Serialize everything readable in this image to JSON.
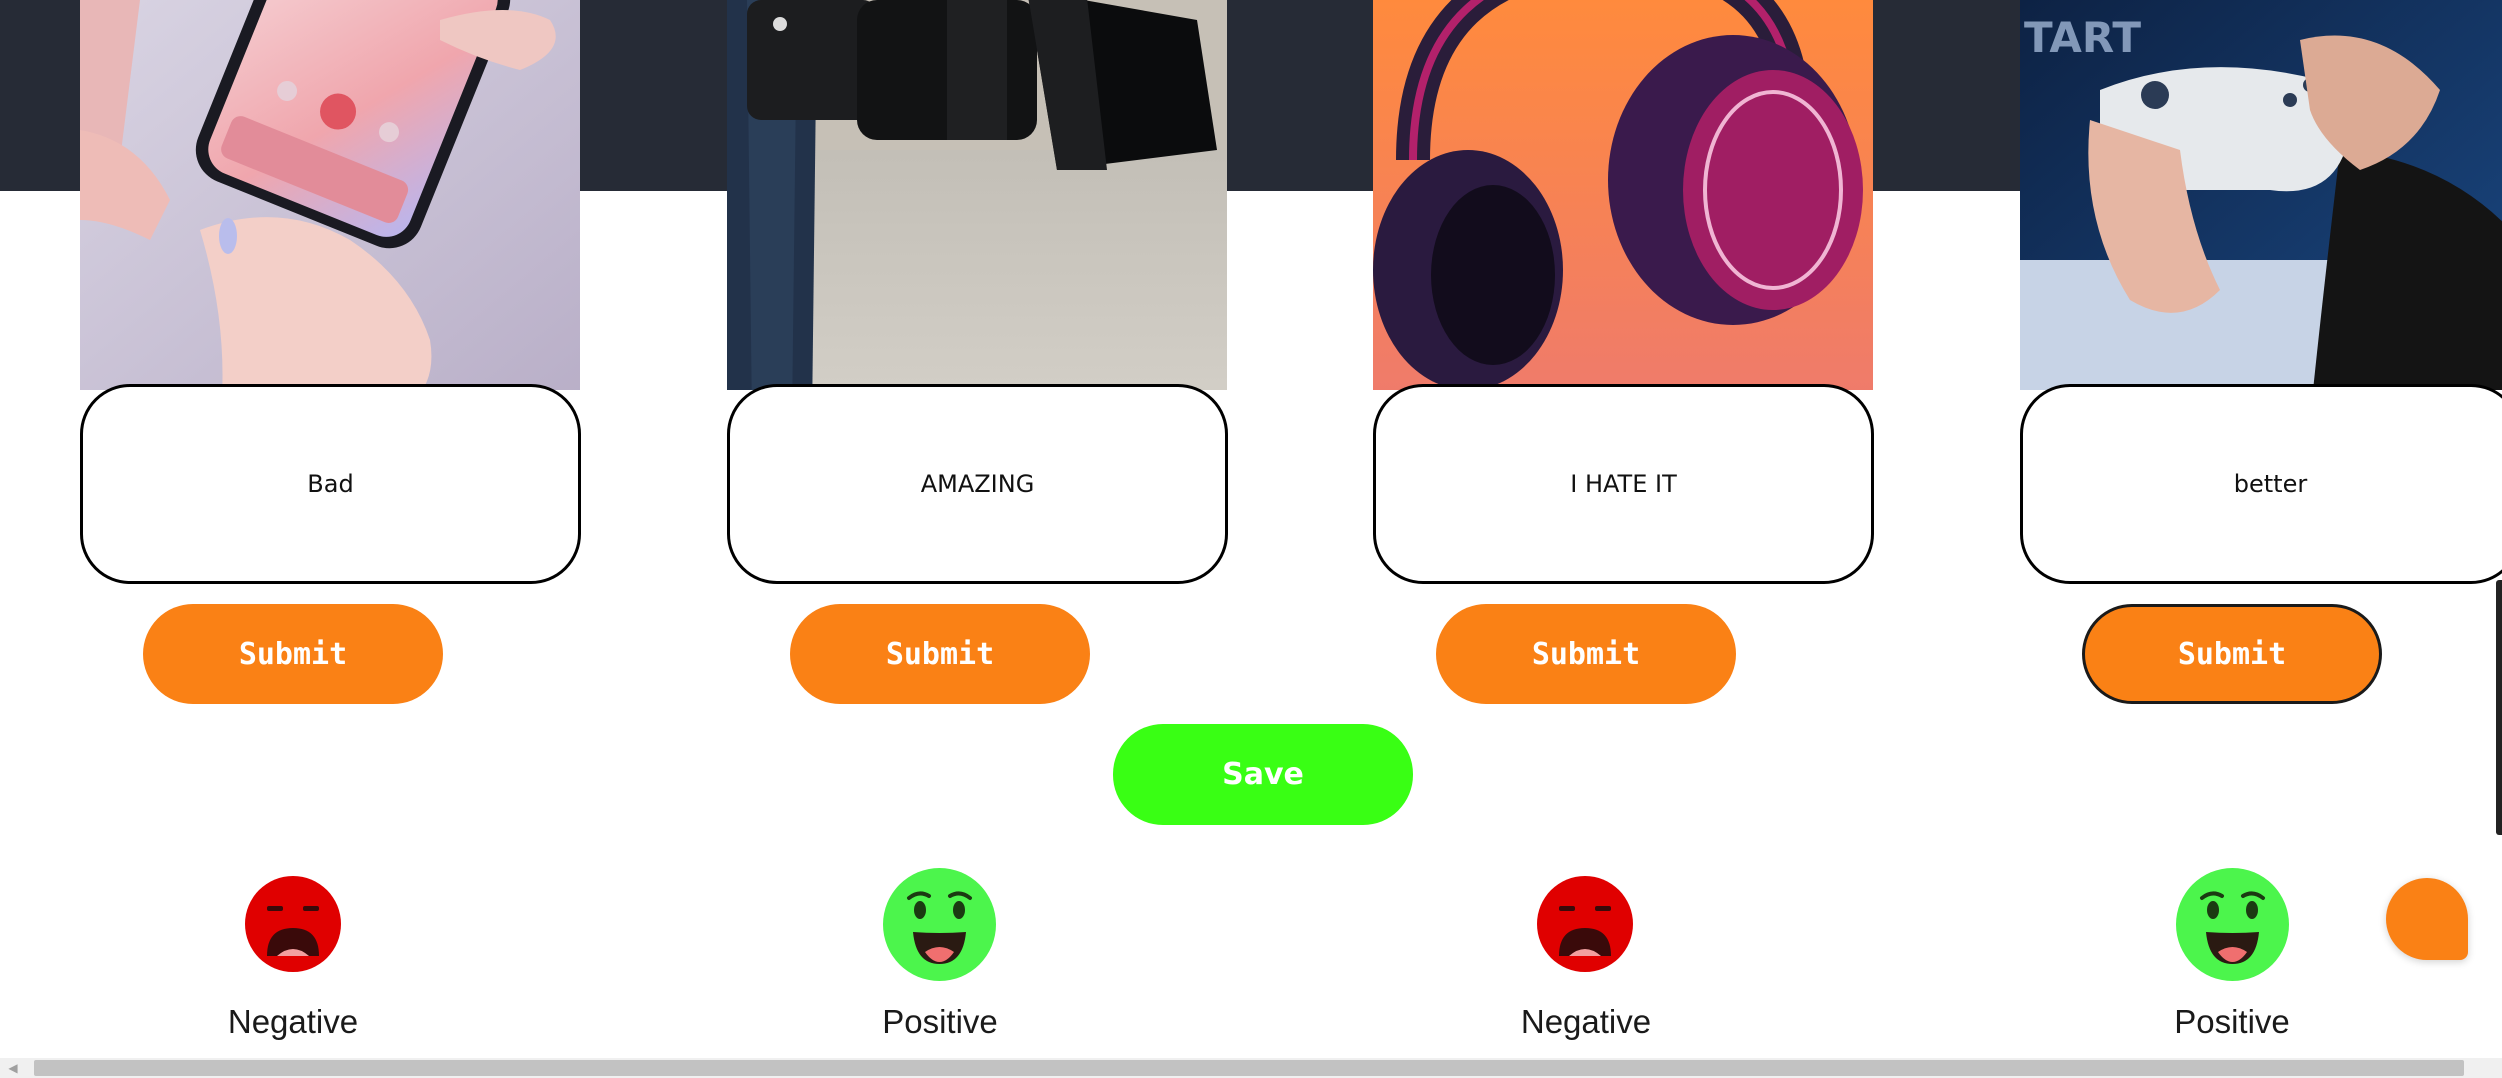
{
  "products": [
    {
      "image": "phone-in-hands-photo",
      "review": "Bad",
      "submit_label": "Submit",
      "sentiment": "Negative",
      "face": "sad-face-icon",
      "face_color": "#e00000"
    },
    {
      "image": "camera-lens-photo",
      "review": "AMAZING",
      "submit_label": "Submit",
      "sentiment": "Positive",
      "face": "happy-face-icon",
      "face_color": "#4cf54c"
    },
    {
      "image": "headphones-photo",
      "review": "I HATE IT",
      "submit_label": "Submit",
      "sentiment": "Negative",
      "face": "sad-face-icon",
      "face_color": "#e00000"
    },
    {
      "image": "game-controller-photo",
      "review": "better",
      "submit_label": "Submit",
      "sentiment": "Positive",
      "face": "happy-face-icon",
      "face_color": "#4cf54c"
    }
  ],
  "save_label": "Save",
  "colors": {
    "header_band": "#262b36",
    "submit_button": "#fa8115",
    "save_button": "#39ff14",
    "negative": "#e00000",
    "positive": "#4cf54c",
    "chat_button": "#fa8115"
  },
  "chat_icon": "chat-bubble-icon",
  "scroll_left_icon": "arrow-left-icon"
}
